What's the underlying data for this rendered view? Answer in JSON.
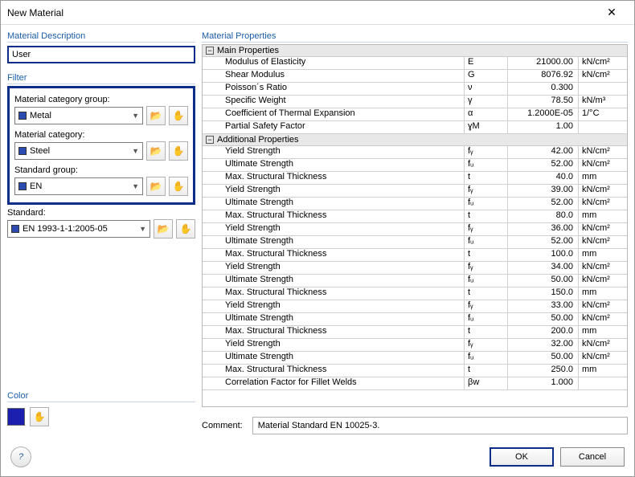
{
  "window": {
    "title": "New Material"
  },
  "description": {
    "group": "Material Description",
    "value": "User"
  },
  "filter": {
    "group": "Filter",
    "catGroup": {
      "label": "Material category group:",
      "value": "Metal",
      "swatch": "#2b4bb3"
    },
    "category": {
      "label": "Material category:",
      "value": "Steel",
      "swatch": "#2b4bb3"
    },
    "stdGroup": {
      "label": "Standard group:",
      "value": "EN",
      "swatch": "#2b4bb3"
    },
    "standard": {
      "label": "Standard:",
      "value": "EN 1993-1-1:2005-05",
      "swatch": "#2b4bb3"
    }
  },
  "color": {
    "group": "Color",
    "value": "#1b1fae"
  },
  "props": {
    "group": "Material Properties",
    "sectionMain": "Main Properties",
    "sectionAdd": "Additional Properties",
    "main": [
      {
        "name": "Modulus of Elasticity",
        "sym": "E",
        "val": "21000.00",
        "unit": "kN/cm²"
      },
      {
        "name": "Shear Modulus",
        "sym": "G",
        "val": "8076.92",
        "unit": "kN/cm²"
      },
      {
        "name": "Poisson´s Ratio",
        "sym": "ν",
        "val": "0.300",
        "unit": ""
      },
      {
        "name": "Specific Weight",
        "sym": "γ",
        "val": "78.50",
        "unit": "kN/m³"
      },
      {
        "name": "Coefficient of Thermal Expansion",
        "sym": "α",
        "val": "1.2000E-05",
        "unit": "1/°C"
      },
      {
        "name": "Partial Safety Factor",
        "sym": "ɣM",
        "val": "1.00",
        "unit": ""
      }
    ],
    "add": [
      {
        "name": "Yield Strength",
        "sym": "fᵧ",
        "val": "42.00",
        "unit": "kN/cm²"
      },
      {
        "name": "Ultimate Strength",
        "sym": "fᵤ",
        "val": "52.00",
        "unit": "kN/cm²"
      },
      {
        "name": "Max. Structural Thickness",
        "sym": "t",
        "val": "40.0",
        "unit": "mm"
      },
      {
        "name": "Yield Strength",
        "sym": "fᵧ",
        "val": "39.00",
        "unit": "kN/cm²"
      },
      {
        "name": "Ultimate Strength",
        "sym": "fᵤ",
        "val": "52.00",
        "unit": "kN/cm²"
      },
      {
        "name": "Max. Structural Thickness",
        "sym": "t",
        "val": "80.0",
        "unit": "mm"
      },
      {
        "name": "Yield Strength",
        "sym": "fᵧ",
        "val": "36.00",
        "unit": "kN/cm²"
      },
      {
        "name": "Ultimate Strength",
        "sym": "fᵤ",
        "val": "52.00",
        "unit": "kN/cm²"
      },
      {
        "name": "Max. Structural Thickness",
        "sym": "t",
        "val": "100.0",
        "unit": "mm"
      },
      {
        "name": "Yield Strength",
        "sym": "fᵧ",
        "val": "34.00",
        "unit": "kN/cm²"
      },
      {
        "name": "Ultimate Strength",
        "sym": "fᵤ",
        "val": "50.00",
        "unit": "kN/cm²"
      },
      {
        "name": "Max. Structural Thickness",
        "sym": "t",
        "val": "150.0",
        "unit": "mm"
      },
      {
        "name": "Yield Strength",
        "sym": "fᵧ",
        "val": "33.00",
        "unit": "kN/cm²"
      },
      {
        "name": "Ultimate Strength",
        "sym": "fᵤ",
        "val": "50.00",
        "unit": "kN/cm²"
      },
      {
        "name": "Max. Structural Thickness",
        "sym": "t",
        "val": "200.0",
        "unit": "mm"
      },
      {
        "name": "Yield Strength",
        "sym": "fᵧ",
        "val": "32.00",
        "unit": "kN/cm²"
      },
      {
        "name": "Ultimate Strength",
        "sym": "fᵤ",
        "val": "50.00",
        "unit": "kN/cm²"
      },
      {
        "name": "Max. Structural Thickness",
        "sym": "t",
        "val": "250.0",
        "unit": "mm"
      },
      {
        "name": "Correlation Factor for Fillet Welds",
        "sym": "βw",
        "val": "1.000",
        "unit": ""
      }
    ]
  },
  "comment": {
    "label": "Comment:",
    "value": "Material Standard EN 10025-3."
  },
  "footer": {
    "ok": "OK",
    "cancel": "Cancel"
  },
  "icons": {
    "folder": "📂",
    "hand": "✋"
  }
}
